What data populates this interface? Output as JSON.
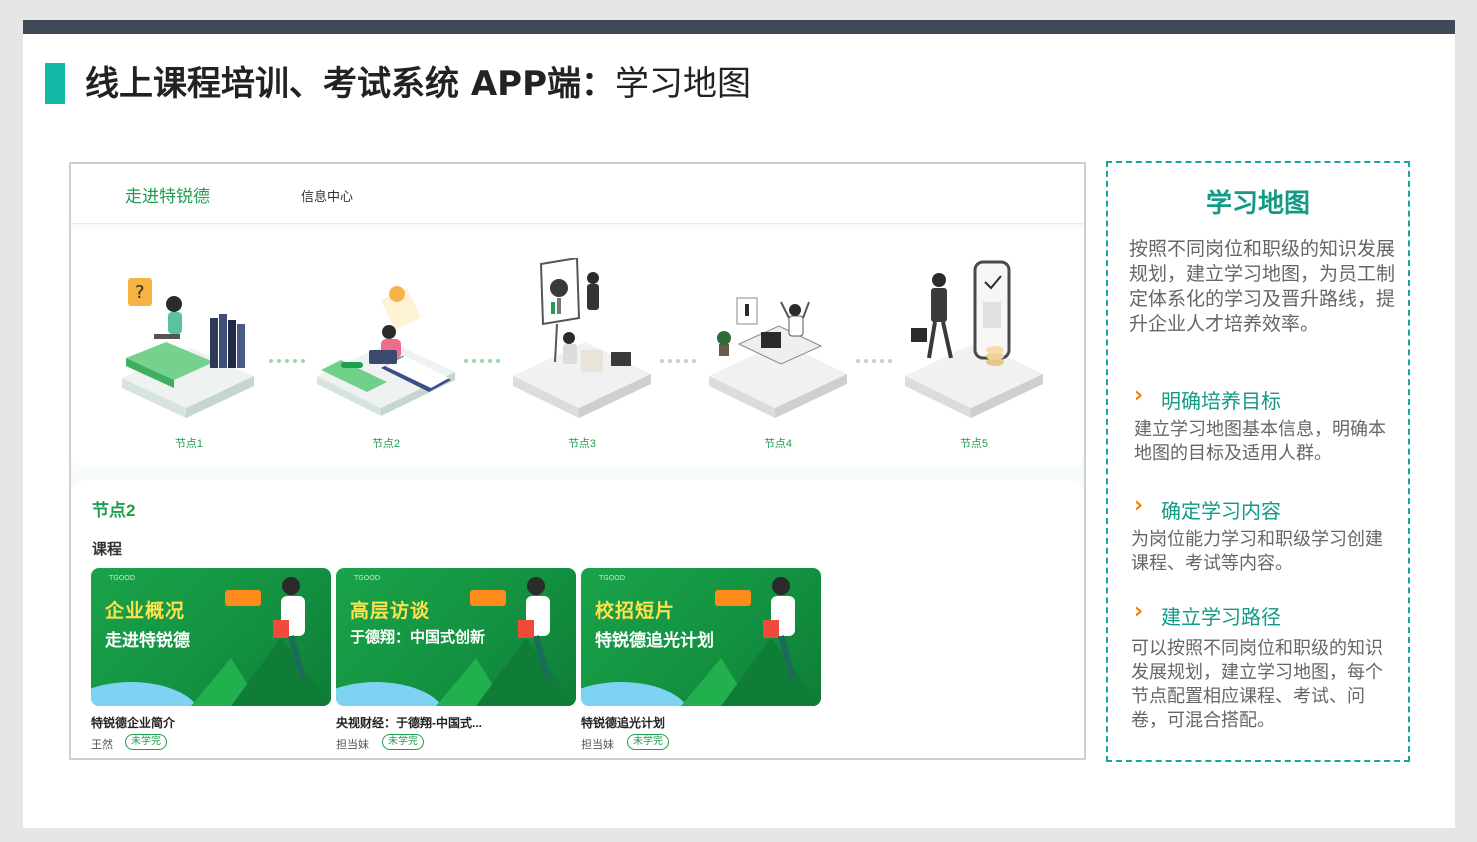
{
  "slide": {
    "title_bold": "线上课程培训、考试系统 APP端：",
    "title_regular": "学习地图"
  },
  "app": {
    "nav": {
      "tab_company": "走进特锐德",
      "tab_info": "信息中心"
    },
    "nodes": [
      {
        "label": "节点1"
      },
      {
        "label": "节点2"
      },
      {
        "label": "节点3"
      },
      {
        "label": "节点4"
      },
      {
        "label": "节点5"
      }
    ],
    "current_node": "节点2",
    "course_section": "课程",
    "courses": [
      {
        "cover_line1": "企业概况",
        "cover_line2": "走进特锐德",
        "title": "特锐德企业简介",
        "author": "王然",
        "status": "未学完"
      },
      {
        "cover_line1": "高层访谈",
        "cover_line2": "于德翔：中国式创新",
        "title": "央视财经：于德翔-中国式...",
        "author": "担当妹",
        "status": "未学完"
      },
      {
        "cover_line1": "校招短片",
        "cover_line2": "特锐德追光计划",
        "title": "特锐德追光计划",
        "author": "担当妹",
        "status": "未学完"
      }
    ],
    "colors": {
      "accent_green": "#1f9d50",
      "cover_green": "#139241"
    }
  },
  "info": {
    "title": "学习地图",
    "desc": "按照不同岗位和职级的知识发展规划，建立学习地图，为员工制定体系化的学习及晋升路线，提升企业人才培养效率。",
    "sections": [
      {
        "heading": "明确培养目标",
        "body": "建立学习地图基本信息，明确本地图的目标及适用人群。"
      },
      {
        "heading": "确定学习内容",
        "body": "为岗位能力学习和职级学习创建课程、考试等内容。"
      },
      {
        "heading": "建立学习路径",
        "body": "可以按照不同岗位和职级的知识发展规划，建立学习地图，每个节点配置相应课程、考试、问卷，可混合搭配。"
      }
    ],
    "colors": {
      "teal": "#139a86",
      "chevron_orange": "#f07c14"
    }
  }
}
